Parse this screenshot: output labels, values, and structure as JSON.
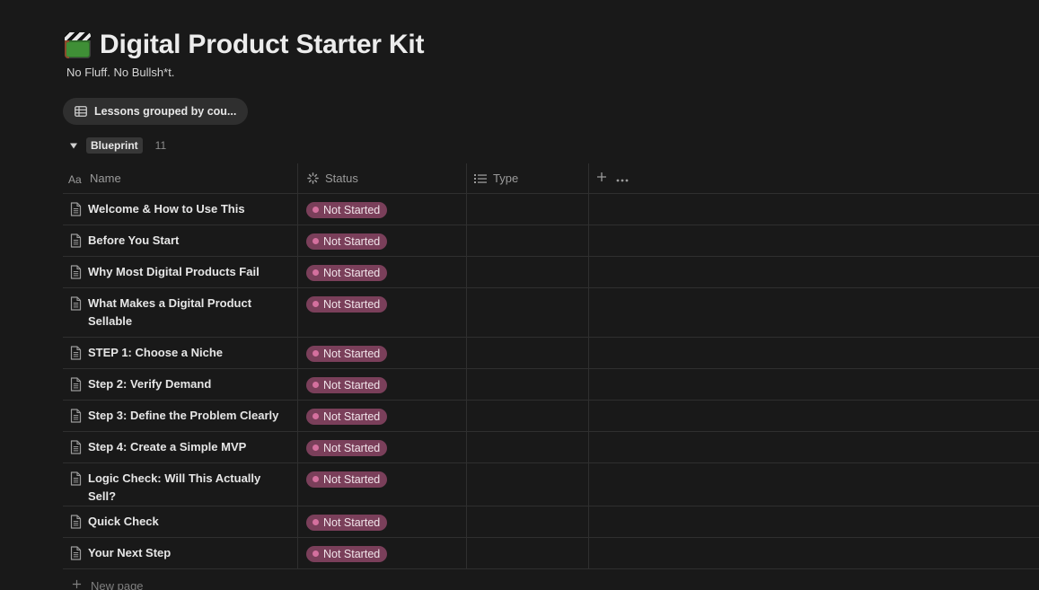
{
  "page": {
    "title": "Digital Product Starter Kit",
    "subtitle": "No Fluff. No Bullsh*t.",
    "icon": "clapperboard-icon"
  },
  "view": {
    "label": "Lessons grouped by cou..."
  },
  "group": {
    "name": "Blueprint",
    "count": "11"
  },
  "columns": {
    "name": "Name",
    "status": "Status",
    "type": "Type"
  },
  "rows": [
    {
      "title": "Welcome & How to Use This",
      "status": "Not Started"
    },
    {
      "title": "Before You Start",
      "status": "Not Started"
    },
    {
      "title": "Why Most Digital Products Fail",
      "status": "Not Started"
    },
    {
      "title": "What Makes a Digital Product Sellable",
      "status": "Not Started"
    },
    {
      "title": "STEP 1: Choose a Niche",
      "status": "Not Started"
    },
    {
      "title": "Step 2: Verify Demand",
      "status": "Not Started"
    },
    {
      "title": "Step 3: Define the Problem Clearly",
      "status": "Not Started"
    },
    {
      "title": "Step 4: Create a Simple MVP",
      "status": "Not Started"
    },
    {
      "title": "Logic Check: Will This Actually Sell?",
      "status": "Not Started"
    },
    {
      "title": "Quick Check",
      "status": "Not Started"
    },
    {
      "title": "Your Next Step",
      "status": "Not Started"
    }
  ],
  "new_page_label": "New page",
  "colors": {
    "status_pill": "#7a3f5a",
    "status_dot": "#d4709e",
    "background": "#191919"
  }
}
